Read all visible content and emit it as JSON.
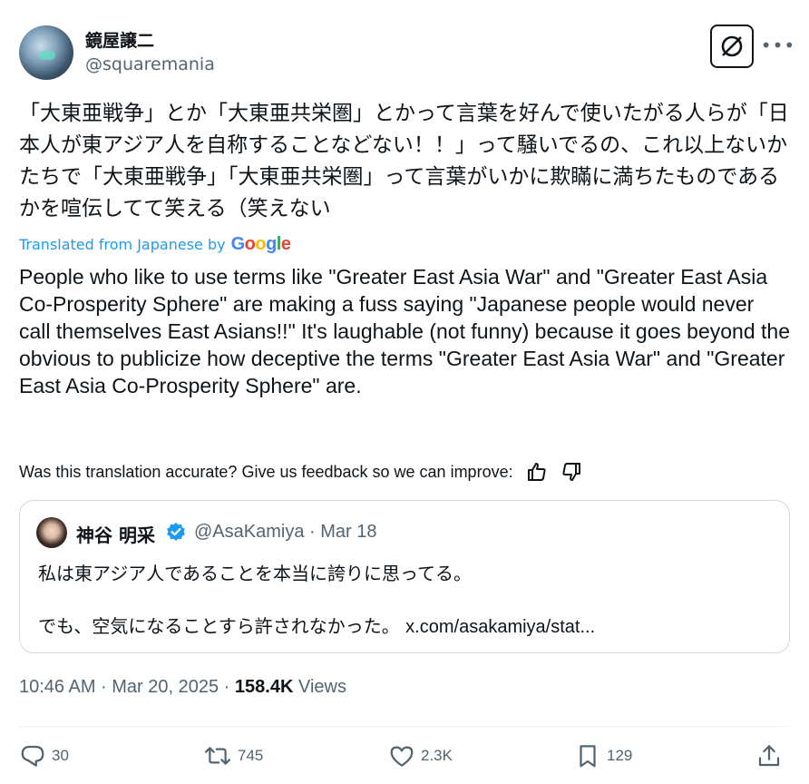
{
  "author": {
    "display_name": "鏡屋譲二",
    "handle": "@squaremania"
  },
  "tweet": {
    "text": "「大東亜戦争」とか「大東亜共栄圏」とかって言葉を好んで使いたがる人らが「日本人が東アジア人を自称することなどない！！」って騒いでるの、これ以上ないかたちで「大東亜戦争」「大東亜共栄圏」って言葉がいかに欺瞞に満ちたものであるかを喧伝してて笑える（笑えない",
    "translated_from_label": "Translated from Japanese by",
    "google_letters": [
      "G",
      "o",
      "o",
      "g",
      "l",
      "e"
    ],
    "google_colors": [
      "#4285F4",
      "#EA4335",
      "#FBBC05",
      "#4285F4",
      "#34A853",
      "#EA4335"
    ],
    "translation": "People who like to use terms like \"Greater East Asia War\" and \"Greater East Asia Co-Prosperity Sphere\" are making a fuss saying \"Japanese people would never call themselves East Asians!!\" It's laughable (not funny) because it goes beyond the obvious to publicize how deceptive the terms \"Greater East Asia War\" and \"Greater East Asia Co-Prosperity Sphere\" are.",
    "feedback_prompt": "Was this translation accurate? Give us feedback so we can improve:"
  },
  "quote": {
    "display_name": "神谷 明采",
    "handle_and_date": "@AsaKamiya · Mar 18",
    "line1": "私は東アジア人であることを本当に誇りに思ってる。",
    "line2_text": "でも、空気になることすら許されなかった。",
    "line2_link": "x.com/asakamiya/stat..."
  },
  "meta": {
    "timestamp": "10:46 AM · Mar 20, 2025 · ",
    "views_count": "158.4K",
    "views_label": " Views"
  },
  "actions": {
    "replies": "30",
    "reposts": "745",
    "likes": "2.3K",
    "bookmarks": "129"
  },
  "colors": {
    "accent": "#1d9bf0",
    "muted": "#536471",
    "text": "#0f1419",
    "border": "#cfd9de"
  }
}
